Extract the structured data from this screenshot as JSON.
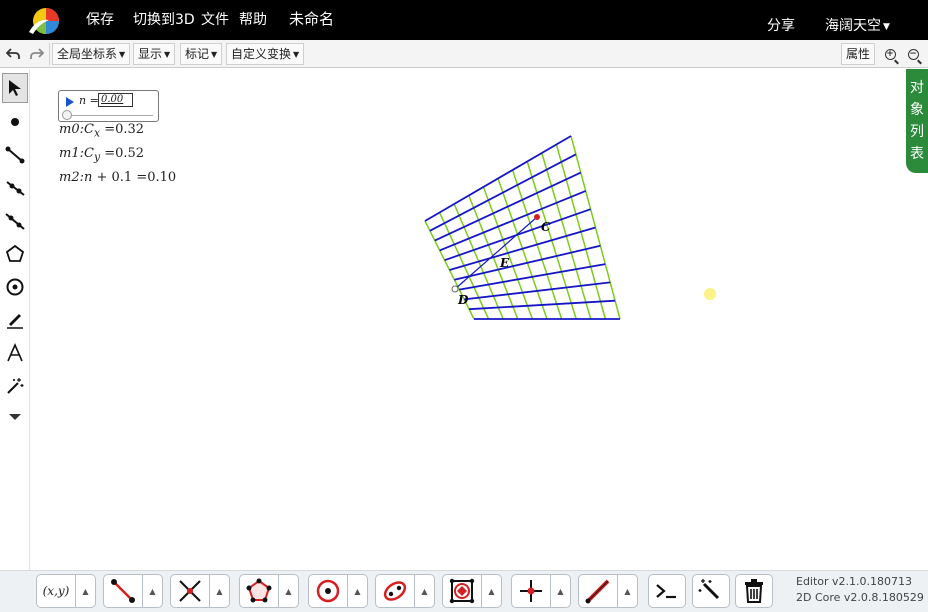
{
  "menu": {
    "save": "保存",
    "switch_3d": "切换到3D",
    "file": "文件",
    "help": "帮助",
    "doc_title": "未命名",
    "share": "分享",
    "user": "海阔天空"
  },
  "toolbar": {
    "coord_system": "全局坐标系",
    "display": "显示",
    "mark": "标记",
    "custom_transform": "自定义变换",
    "properties": "属性"
  },
  "slider": {
    "label": "n =",
    "value": "0.00",
    "position_fraction": 0.0
  },
  "measurements": {
    "m0_name": "m0:",
    "m0_var": "C",
    "m0_sub": "x",
    "m0_value": "=0.32",
    "m1_name": "m1:",
    "m1_var": "C",
    "m1_sub": "y",
    "m1_value": "=0.52",
    "m2_name": "m2:",
    "m2_expr": "n",
    "m2_rest": " + 0.1 =0.10"
  },
  "points": {
    "C": "C",
    "E": "E",
    "D": "D"
  },
  "object_list": [
    "对",
    "象",
    "列",
    "表"
  ],
  "bottom_tools": {
    "coords": "(x,y)",
    "caret": "▲"
  },
  "version": {
    "editor": "Editor v2.1.0.180713",
    "core": "2D Core v2.0.8.180529"
  },
  "colors": {
    "grid_blue": "#1515c8",
    "grid_green": "#7ccc1a",
    "point_red": "#d42020",
    "accent_green": "#2c8a3b"
  }
}
